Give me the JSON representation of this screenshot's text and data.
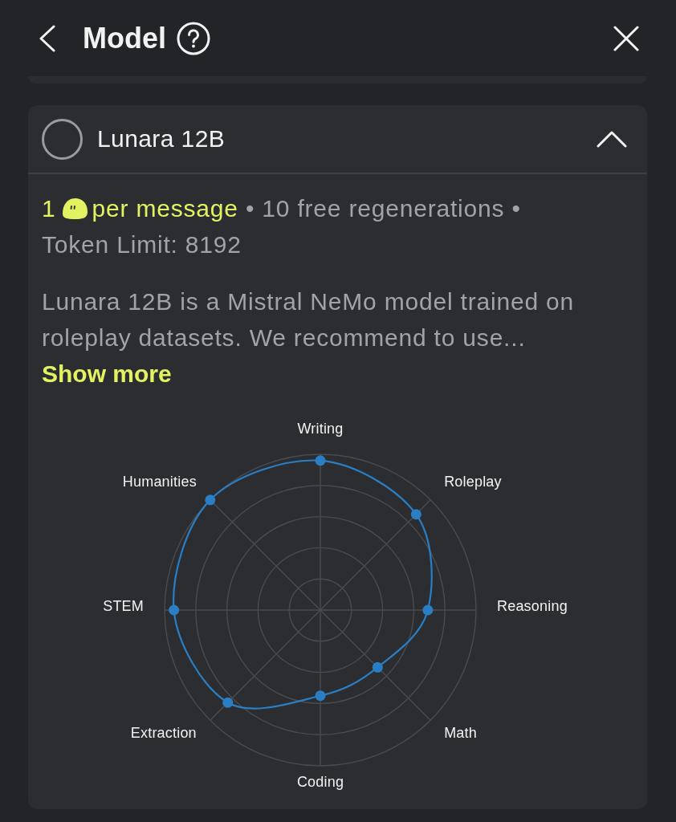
{
  "header": {
    "title": "Model"
  },
  "model_card": {
    "name": "Lunara 12B",
    "selected": false,
    "expanded": true,
    "price": {
      "amount": "1",
      "unit": "per message"
    },
    "features": [
      {
        "separator": "•",
        "text": "10 free regenerations"
      },
      {
        "separator": "•",
        "text": "Token Limit: 8192"
      }
    ],
    "description": "Lunara 12B is a Mistral NeMo model trained on roleplay datasets. We recommend to use...",
    "show_more": "Show more",
    "radar": {
      "axes": [
        "Writing",
        "Roleplay",
        "Reasoning",
        "Math",
        "Coding",
        "Extraction",
        "STEM",
        "Humanities"
      ]
    }
  }
}
